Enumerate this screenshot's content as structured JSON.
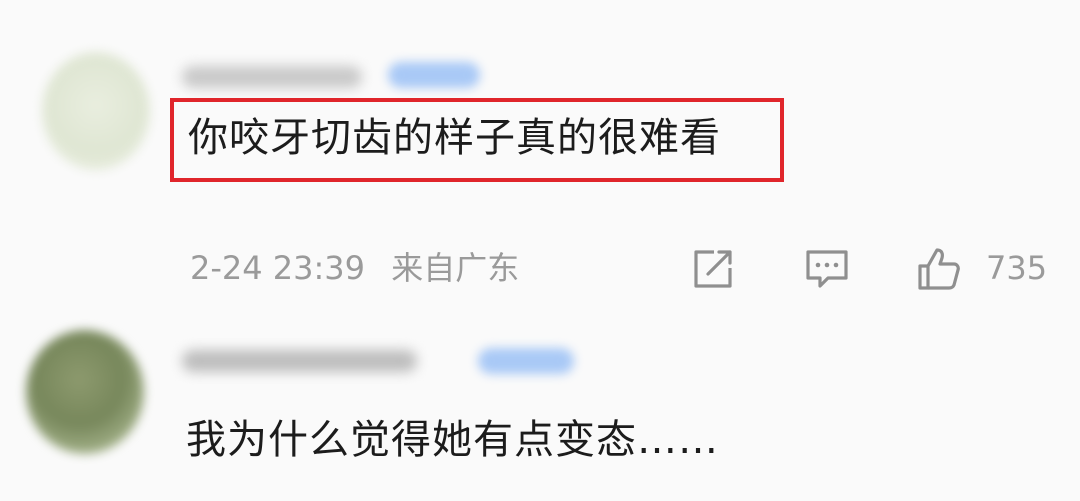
{
  "comments": [
    {
      "text": "你咬牙切齿的样子真的很难看",
      "date": "2-24 23:39",
      "location": "来自广东",
      "likes": "735",
      "highlighted": true
    },
    {
      "text": "我为什么觉得她有点变态……"
    }
  ],
  "icons": {
    "share": "share-icon",
    "reply": "comment-icon",
    "like": "thumbs-up-icon"
  },
  "colors": {
    "highlight_border": "#e0252b",
    "meta_text": "#9a9a9a",
    "badge": "#a9c9f6"
  }
}
